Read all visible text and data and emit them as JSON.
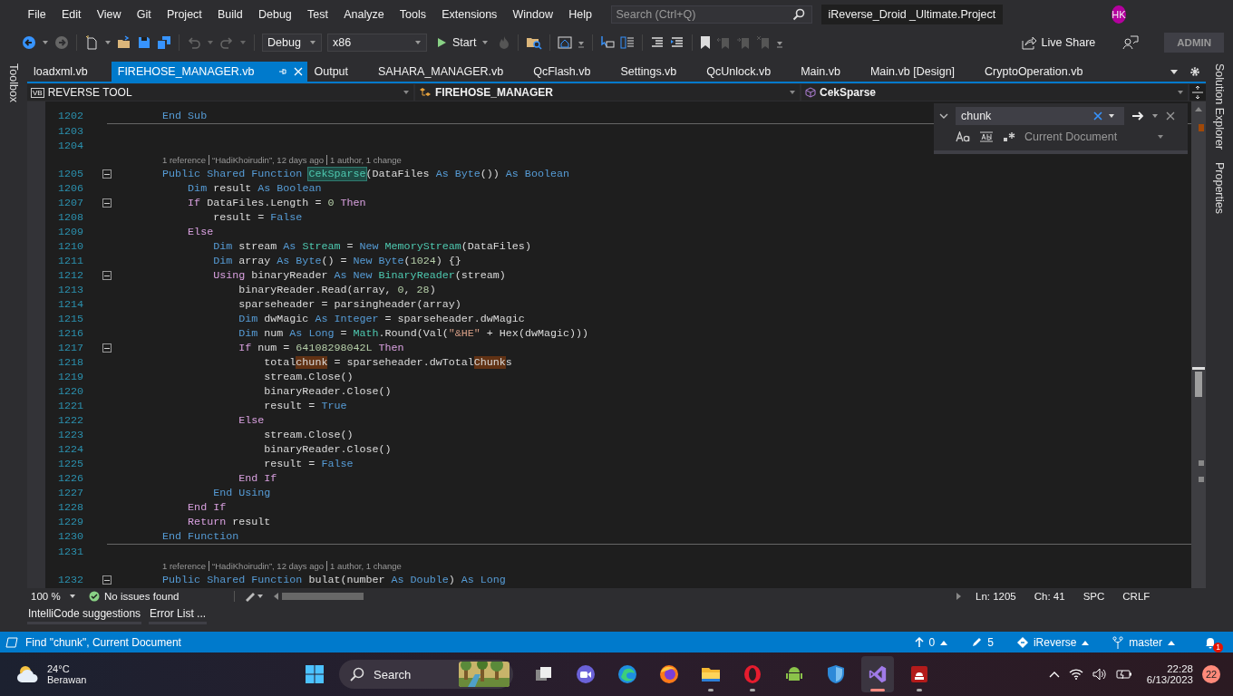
{
  "menu": [
    "File",
    "Edit",
    "View",
    "Git",
    "Project",
    "Build",
    "Debug",
    "Test",
    "Analyze",
    "Tools",
    "Extensions",
    "Window",
    "Help"
  ],
  "search": {
    "placeholder": "Search (Ctrl+Q)"
  },
  "solution_name": "iReverse_Droid _Ultimate.Project",
  "user_initials": "HK",
  "toolbar": {
    "configuration": "Debug",
    "platform": "x86",
    "start": "Start",
    "live_share": "Live Share",
    "account": "ADMIN"
  },
  "side_left": [
    "Toolbox"
  ],
  "side_right": [
    "Solution Explorer",
    "Properties"
  ],
  "tabs": [
    {
      "label": "loadxml.vb",
      "selected": false
    },
    {
      "label": "FIREHOSE_MANAGER.vb",
      "selected": true
    },
    {
      "label": "Output",
      "selected": false
    },
    {
      "label": "SAHARA_MANAGER.vb",
      "selected": false
    },
    {
      "label": "QcFlash.vb",
      "selected": false
    },
    {
      "label": "Settings.vb",
      "selected": false
    },
    {
      "label": "QcUnlock.vb",
      "selected": false
    },
    {
      "label": "Main.vb",
      "selected": false
    },
    {
      "label": "Main.vb [Design]",
      "selected": false
    },
    {
      "label": "CryptoOperation.vb",
      "selected": false
    }
  ],
  "nav": {
    "project_badge": "VB",
    "project": "REVERSE TOOL",
    "class": "FIREHOSE_MANAGER",
    "member": "CekSparse"
  },
  "code": [
    {
      "kind": "code",
      "number": "1202",
      "fold": false,
      "separator": true,
      "tokens": [
        {
          "text": "    End Sub",
          "kind": "kw"
        }
      ]
    },
    {
      "kind": "code",
      "number": "1203",
      "fold": false,
      "separator": false
    },
    {
      "kind": "code",
      "number": "1204",
      "fold": false,
      "separator": false
    },
    {
      "kind": "lens",
      "parts": [
        "1 reference",
        "“HadiKhoirudin”, 12 days ago",
        "1 author, 1 change"
      ]
    },
    {
      "kind": "code",
      "number": "1205",
      "fold": true,
      "separator": false,
      "tokens": [
        {
          "text": "    Public Shared Function ",
          "kind": "kw"
        },
        {
          "text": "CekSparse",
          "kind": "ref"
        },
        {
          "text": "(DataFiles ",
          "kind": "id"
        },
        {
          "text": "As Byte",
          "kind": "kw"
        },
        {
          "text": "()) ",
          "kind": "id"
        },
        {
          "text": "As Boolean",
          "kind": "kw"
        }
      ]
    },
    {
      "kind": "code",
      "number": "1206",
      "fold": false,
      "separator": false,
      "tokens": [
        {
          "text": "        Dim ",
          "kind": "kw"
        },
        {
          "text": "result ",
          "kind": "id"
        },
        {
          "text": "As Boolean",
          "kind": "kw"
        }
      ]
    },
    {
      "kind": "code",
      "number": "1207",
      "fold": true,
      "separator": false,
      "tokens": [
        {
          "text": "        If ",
          "kind": "ctl"
        },
        {
          "text": "DataFiles.Length = ",
          "kind": "id"
        },
        {
          "text": "0",
          "kind": "num"
        },
        {
          "text": " Then",
          "kind": "ctl"
        }
      ]
    },
    {
      "kind": "code",
      "number": "1208",
      "fold": false,
      "separator": false,
      "tokens": [
        {
          "text": "            result = ",
          "kind": "id"
        },
        {
          "text": "False",
          "kind": "kw"
        }
      ]
    },
    {
      "kind": "code",
      "number": "1209",
      "fold": false,
      "separator": false,
      "tokens": [
        {
          "text": "        Else",
          "kind": "ctl"
        }
      ]
    },
    {
      "kind": "code",
      "number": "1210",
      "fold": false,
      "separator": false,
      "tokens": [
        {
          "text": "            Dim ",
          "kind": "kw"
        },
        {
          "text": "stream ",
          "kind": "id"
        },
        {
          "text": "As ",
          "kind": "kw"
        },
        {
          "text": "Stream",
          "kind": "type"
        },
        {
          "text": " = ",
          "kind": "id"
        },
        {
          "text": "New ",
          "kind": "kw"
        },
        {
          "text": "MemoryStream",
          "kind": "type"
        },
        {
          "text": "(DataFiles)",
          "kind": "id"
        }
      ]
    },
    {
      "kind": "code",
      "number": "1211",
      "fold": false,
      "separator": false,
      "tokens": [
        {
          "text": "            Dim ",
          "kind": "kw"
        },
        {
          "text": "array ",
          "kind": "id"
        },
        {
          "text": "As Byte",
          "kind": "kw"
        },
        {
          "text": "() = ",
          "kind": "id"
        },
        {
          "text": "New Byte",
          "kind": "kw"
        },
        {
          "text": "(",
          "kind": "id"
        },
        {
          "text": "1024",
          "kind": "num"
        },
        {
          "text": ") {}",
          "kind": "id"
        }
      ]
    },
    {
      "kind": "code",
      "number": "1212",
      "fold": true,
      "separator": false,
      "tokens": [
        {
          "text": "            Using ",
          "kind": "ctl"
        },
        {
          "text": "binaryReader ",
          "kind": "id"
        },
        {
          "text": "As New ",
          "kind": "kw"
        },
        {
          "text": "BinaryReader",
          "kind": "type"
        },
        {
          "text": "(stream)",
          "kind": "id"
        }
      ]
    },
    {
      "kind": "code",
      "number": "1213",
      "fold": false,
      "separator": false,
      "tokens": [
        {
          "text": "                binaryReader.Read(array, ",
          "kind": "id"
        },
        {
          "text": "0",
          "kind": "num"
        },
        {
          "text": ", ",
          "kind": "id"
        },
        {
          "text": "28",
          "kind": "num"
        },
        {
          "text": ")",
          "kind": "id"
        }
      ]
    },
    {
      "kind": "code",
      "number": "1214",
      "fold": false,
      "separator": false,
      "tokens": [
        {
          "text": "                sparseheader = parsingheader(array)",
          "kind": "id"
        }
      ]
    },
    {
      "kind": "code",
      "number": "1215",
      "fold": false,
      "separator": false,
      "tokens": [
        {
          "text": "                Dim ",
          "kind": "kw"
        },
        {
          "text": "dwMagic ",
          "kind": "id"
        },
        {
          "text": "As Integer",
          "kind": "kw"
        },
        {
          "text": " = sparseheader.dwMagic",
          "kind": "id"
        }
      ]
    },
    {
      "kind": "code",
      "number": "1216",
      "fold": false,
      "separator": false,
      "tokens": [
        {
          "text": "                Dim ",
          "kind": "kw"
        },
        {
          "text": "num ",
          "kind": "id"
        },
        {
          "text": "As Long",
          "kind": "kw"
        },
        {
          "text": " = ",
          "kind": "id"
        },
        {
          "text": "Math",
          "kind": "type"
        },
        {
          "text": ".Round(Val(",
          "kind": "id"
        },
        {
          "text": "\"&HE\"",
          "kind": "str"
        },
        {
          "text": " + Hex(dwMagic)))",
          "kind": "id"
        }
      ]
    },
    {
      "kind": "code",
      "number": "1217",
      "fold": true,
      "separator": false,
      "tokens": [
        {
          "text": "                If ",
          "kind": "ctl"
        },
        {
          "text": "num = ",
          "kind": "id"
        },
        {
          "text": "64108298042L",
          "kind": "num"
        },
        {
          "text": " Then",
          "kind": "ctl"
        }
      ]
    },
    {
      "kind": "code",
      "number": "1218",
      "fold": false,
      "separator": false,
      "tokens": [
        {
          "text": "                    total",
          "kind": "id"
        },
        {
          "text": "chunk",
          "kind": "match"
        },
        {
          "text": " = sparseheader.dwTotal",
          "kind": "id"
        },
        {
          "text": "Chunk",
          "kind": "match"
        },
        {
          "text": "s",
          "kind": "id"
        }
      ]
    },
    {
      "kind": "code",
      "number": "1219",
      "fold": false,
      "separator": false,
      "tokens": [
        {
          "text": "                    stream.Close()",
          "kind": "id"
        }
      ]
    },
    {
      "kind": "code",
      "number": "1220",
      "fold": false,
      "separator": false,
      "tokens": [
        {
          "text": "                    binaryReader.Close()",
          "kind": "id"
        }
      ]
    },
    {
      "kind": "code",
      "number": "1221",
      "fold": false,
      "separator": false,
      "tokens": [
        {
          "text": "                    result = ",
          "kind": "id"
        },
        {
          "text": "True",
          "kind": "kw"
        }
      ]
    },
    {
      "kind": "code",
      "number": "1222",
      "fold": false,
      "separator": false,
      "tokens": [
        {
          "text": "                Else",
          "kind": "ctl"
        }
      ]
    },
    {
      "kind": "code",
      "number": "1223",
      "fold": false,
      "separator": false,
      "tokens": [
        {
          "text": "                    stream.Close()",
          "kind": "id"
        }
      ]
    },
    {
      "kind": "code",
      "number": "1224",
      "fold": false,
      "separator": false,
      "tokens": [
        {
          "text": "                    binaryReader.Close()",
          "kind": "id"
        }
      ]
    },
    {
      "kind": "code",
      "number": "1225",
      "fold": false,
      "separator": false,
      "tokens": [
        {
          "text": "                    result = ",
          "kind": "id"
        },
        {
          "text": "False",
          "kind": "kw"
        }
      ]
    },
    {
      "kind": "code",
      "number": "1226",
      "fold": false,
      "separator": false,
      "tokens": [
        {
          "text": "                End If",
          "kind": "ctl"
        }
      ]
    },
    {
      "kind": "code",
      "number": "1227",
      "fold": false,
      "separator": false,
      "tokens": [
        {
          "text": "            End Using",
          "kind": "kw"
        }
      ]
    },
    {
      "kind": "code",
      "number": "1228",
      "fold": false,
      "separator": false,
      "tokens": [
        {
          "text": "        End If",
          "kind": "ctl"
        }
      ]
    },
    {
      "kind": "code",
      "number": "1229",
      "fold": false,
      "separator": false,
      "tokens": [
        {
          "text": "        Return ",
          "kind": "ctl"
        },
        {
          "text": "result",
          "kind": "id"
        }
      ]
    },
    {
      "kind": "code",
      "number": "1230",
      "fold": false,
      "separator": true,
      "tokens": [
        {
          "text": "    End Function",
          "kind": "kw"
        }
      ]
    },
    {
      "kind": "code",
      "number": "1231",
      "fold": false,
      "separator": false
    },
    {
      "kind": "lens",
      "parts": [
        "1 reference",
        "“HadiKhoirudin”, 12 days ago",
        "1 author, 1 change"
      ]
    },
    {
      "kind": "code",
      "number": "1232",
      "fold": true,
      "separator": false,
      "tokens": [
        {
          "text": "    Public Shared Function ",
          "kind": "kw"
        },
        {
          "text": "bulat",
          "kind": "id"
        },
        {
          "text": "(number ",
          "kind": "id"
        },
        {
          "text": "As Double",
          "kind": "kw"
        },
        {
          "text": ") ",
          "kind": "id"
        },
        {
          "text": "As Long",
          "kind": "kw"
        }
      ]
    }
  ],
  "find": {
    "value": "chunk",
    "scope": "Current Document"
  },
  "editor_status": {
    "zoom": "100 %",
    "issues": "No issues found",
    "line": "Ln: 1205",
    "column": "Ch: 41",
    "indent": "SPC",
    "line_ending": "CRLF"
  },
  "tool_tabs": [
    "IntelliCode suggestions",
    "Error List ..."
  ],
  "status_bar": {
    "message": "Find \"chunk\", Current Document",
    "commits": "0",
    "changes": "5",
    "repository": "iReverse",
    "branch": "master",
    "notifications": "1"
  },
  "taskbar": {
    "temperature": "24°C",
    "weather": "Berawan",
    "search": "Search",
    "time": "22:28",
    "date": "6/13/2023",
    "notification_count": "22",
    "apps": [
      {
        "kind": "taskview",
        "running": false,
        "active": false
      },
      {
        "kind": "chat",
        "running": false,
        "active": false
      },
      {
        "kind": "edge",
        "running": false,
        "active": false
      },
      {
        "kind": "firefox",
        "running": false,
        "active": false
      },
      {
        "kind": "folder",
        "running": true,
        "active": false
      },
      {
        "kind": "opera",
        "running": true,
        "active": false
      },
      {
        "kind": "android",
        "running": false,
        "active": false
      },
      {
        "kind": "shield",
        "running": false,
        "active": false
      },
      {
        "kind": "vs",
        "running": true,
        "active": true
      },
      {
        "kind": "toolbox",
        "running": true,
        "active": false
      }
    ]
  }
}
